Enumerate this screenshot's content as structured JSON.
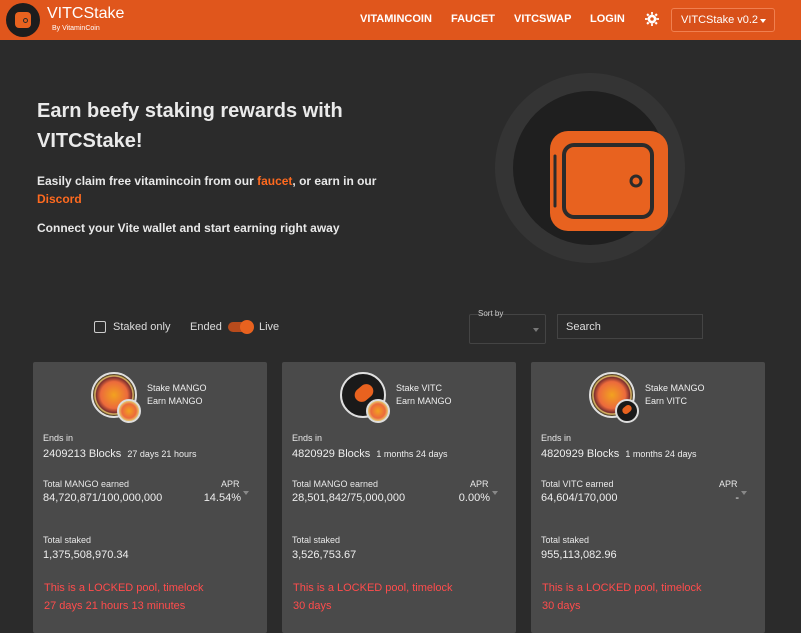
{
  "header": {
    "brand": "VITCStake",
    "brand_sub": "By VitaminCoin",
    "nav": [
      "VITAMINCOIN",
      "FAUCET",
      "VITCSWAP",
      "LOGIN"
    ],
    "version": "VITCStake v0.2"
  },
  "hero": {
    "title": "Earn beefy staking rewards with VITCStake!",
    "p1_before": "Easily claim free vitamincoin from our ",
    "p1_link1": "faucet",
    "p1_middle": ", or earn in our ",
    "p1_link2": "Discord",
    "p2": "Connect your Vite wallet and start earning right away"
  },
  "filters": {
    "staked_only": "Staked only",
    "ended": "Ended",
    "live": "Live",
    "sort_by": "Sort by",
    "search_placeholder": "Search"
  },
  "colors": {
    "accent": "#e0561c",
    "locked_text": "#ff4c4c",
    "card_bg": "#4a4a4a",
    "page_bg": "#2b2b2b"
  },
  "pools": [
    {
      "stake_line": "Stake MANGO",
      "earn_line": "Earn MANGO",
      "ends_in_label": "Ends in",
      "blocks": "2409213 Blocks",
      "ends_time": "27 days 21 hours",
      "earned_label": "Total MANGO earned",
      "earned": "84,720,871/100,000,000",
      "apr_label": "APR",
      "apr": "14.54%",
      "staked_label": "Total staked",
      "staked": "1,375,508,970.34",
      "locked": "This is a LOCKED pool, timelock",
      "timelock": "27 days 21 hours 13 minutes"
    },
    {
      "stake_line": "Stake VITC",
      "earn_line": "Earn MANGO",
      "ends_in_label": "Ends in",
      "blocks": "4820929 Blocks",
      "ends_time": "1 months 24 days",
      "earned_label": "Total MANGO earned",
      "earned": "28,501,842/75,000,000",
      "apr_label": "APR",
      "apr": "0.00%",
      "staked_label": "Total staked",
      "staked": "3,526,753.67",
      "locked": "This is a LOCKED pool, timelock",
      "timelock": "30 days"
    },
    {
      "stake_line": "Stake MANGO",
      "earn_line": "Earn VITC",
      "ends_in_label": "Ends in",
      "blocks": "4820929 Blocks",
      "ends_time": "1 months 24 days",
      "earned_label": "Total VITC earned",
      "earned": "64,604/170,000",
      "apr_label": "APR",
      "apr": "-",
      "staked_label": "Total staked",
      "staked": "955,113,082.96",
      "locked": "This is a LOCKED pool, timelock",
      "timelock": "30 days"
    }
  ]
}
